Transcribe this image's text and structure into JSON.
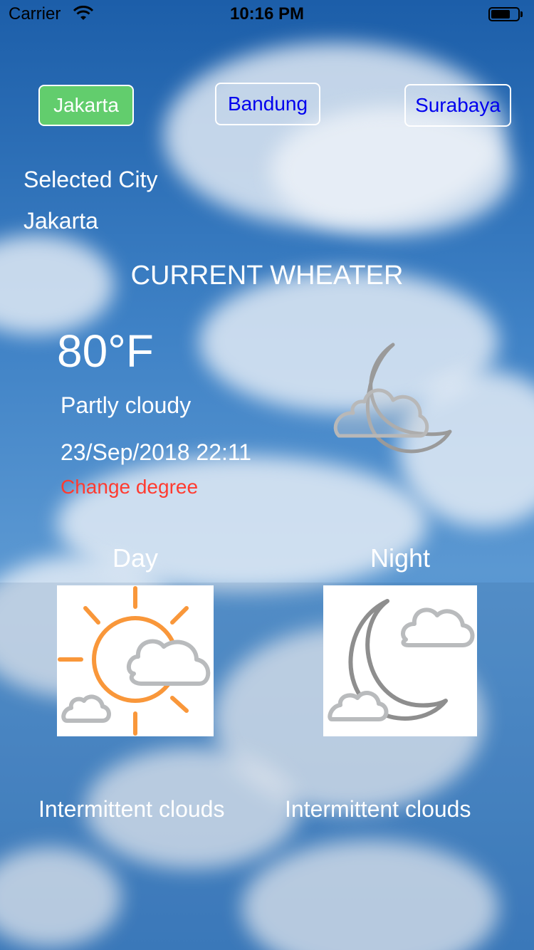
{
  "status_bar": {
    "carrier": "Carrier",
    "time": "10:16 PM",
    "icons": [
      "wifi-icon",
      "battery-icon"
    ]
  },
  "city_selector": {
    "buttons": [
      {
        "label": "Jakarta",
        "active": true
      },
      {
        "label": "Bandung",
        "active": false
      },
      {
        "label": "Surabaya",
        "active": false
      }
    ]
  },
  "selected_city": {
    "label": "Selected City",
    "value": "Jakarta"
  },
  "current_weather": {
    "heading": "CURRENT WHEATER",
    "temperature": "80°F",
    "condition": "Partly cloudy",
    "datetime": "23/Sep/2018 22:11",
    "change_degree_label": "Change degree",
    "icon": "moon-cloud-icon"
  },
  "forecast": {
    "day": {
      "label": "Day",
      "condition": "Intermittent clouds",
      "icon": "sun-cloud-icon"
    },
    "night": {
      "label": "Night",
      "condition": "Intermittent clouds",
      "icon": "moon-clouds-icon"
    }
  },
  "colors": {
    "active_button": "#62cd6d",
    "button_text": "#0000ee",
    "link_red": "#ff3b30",
    "sun_orange": "#f9973a",
    "cloud_gray": "#b9bbbd",
    "moon_gray": "#8e8e8e"
  }
}
